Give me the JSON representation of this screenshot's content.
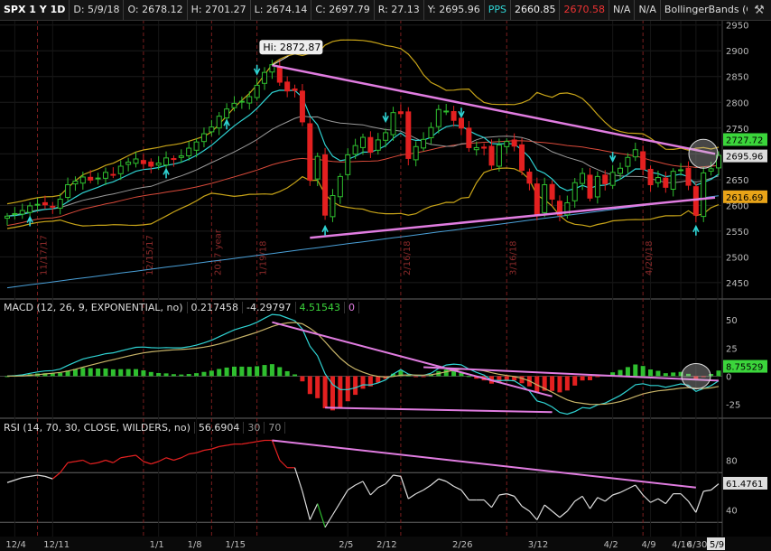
{
  "header": {
    "symbol": "SPX 1 Y 1D",
    "date": "D: 5/9/18",
    "open": "O: 2678.12",
    "high": "H: 2701.27",
    "low": "L: 2674.14",
    "close": "C: 2697.79",
    "range": "R: 27.13",
    "prev": "Y: 2695.96",
    "pps_label": "PPS",
    "pps_value1": "2660.85",
    "pps_value2": "2670.58",
    "na1": "N/A",
    "na2": "N/A",
    "study": "BollingerBands (CLOSE,..."
  },
  "macd_header": {
    "name": "MACD (12, 26, 9, EXPONENTIAL, no)",
    "v1": "0.217458",
    "v2": "-4.29797",
    "v3": "4.51543",
    "v4": "0"
  },
  "rsi_header": {
    "name": "RSI (14, 70, 30, CLOSE, WILDERS, no)",
    "v1": "56.6904",
    "v2": "30",
    "v3": "70"
  },
  "colors": {
    "up": "#2fbf2f",
    "down": "#e32020",
    "bollinger": "#c8a418",
    "ma_short": "#2fd3d3",
    "ma_mid": "#9a9a9a",
    "ma_long": "#d94a3a",
    "ma_200": "#4aa0d8",
    "trendline": "#e07ce0"
  },
  "chart_data": [
    {
      "type": "line",
      "title": "SPX 1 Y 1D",
      "ylim": [
        2420,
        2960
      ],
      "y_ticks": [
        2450,
        2500,
        2550,
        2600,
        2650,
        2700,
        2750,
        2800,
        2850,
        2900,
        2950
      ],
      "x_tick_labels": [
        "12/4",
        "12/11",
        "1/1",
        "1/8",
        "1/15",
        "2/5",
        "2/12",
        "2/26",
        "3/12",
        "4/2",
        "4/9",
        "4/16",
        "4/30",
        "5/9"
      ],
      "vertical_markers": [
        "11/17/17",
        "12/15/17",
        "2017 year",
        "1/19/18",
        "2/16/18",
        "3/16/18",
        "4/20/18"
      ],
      "annotations": [
        "Hi: 2872.87"
      ],
      "price_tags": {
        "upper_band": "2727.72",
        "last": "2695.96",
        "lower_band": "2616.69"
      },
      "close_series": [
        2579,
        2584,
        2590,
        2599,
        2602,
        2601,
        2597,
        2612,
        2640,
        2647,
        2655,
        2649,
        2653,
        2664,
        2660,
        2676,
        2684,
        2690,
        2681,
        2676,
        2682,
        2692,
        2689,
        2696,
        2711,
        2723,
        2739,
        2752,
        2773,
        2787,
        2798,
        2802,
        2811,
        2833,
        2858,
        2873,
        2839,
        2822,
        2823,
        2762,
        2649,
        2695,
        2581,
        2619,
        2656,
        2698,
        2716,
        2732,
        2703,
        2727,
        2741,
        2780,
        2778,
        2691,
        2714,
        2728,
        2751,
        2786,
        2783,
        2765,
        2750,
        2712,
        2712,
        2711,
        2678,
        2717,
        2724,
        2715,
        2668,
        2643,
        2582,
        2640,
        2612,
        2581,
        2605,
        2644,
        2662,
        2614,
        2656,
        2642,
        2664,
        2672,
        2693,
        2708,
        2670,
        2640,
        2654,
        2635,
        2666,
        2669,
        2639,
        2581,
        2663,
        2671,
        2697
      ],
      "series": [
        {
          "name": "Bollinger Upper",
          "values": []
        },
        {
          "name": "Bollinger Lower",
          "values": []
        }
      ]
    },
    {
      "type": "bar",
      "title": "MACD (12, 26, 9, EXPONENTIAL, no)",
      "ylim": [
        -35,
        55
      ],
      "y_ticks": [
        -25,
        0,
        25,
        50
      ],
      "last_value": "8.75529"
    },
    {
      "type": "line",
      "title": "RSI (14, 70, 30, CLOSE, WILDERS, no)",
      "ylim": [
        20,
        100
      ],
      "y_ticks": [
        40,
        80
      ],
      "last_value": "61.4761",
      "values": [
        62,
        64,
        66,
        67,
        68,
        67,
        65,
        70,
        78,
        79,
        80,
        77,
        78,
        80,
        78,
        82,
        83,
        84,
        79,
        77,
        79,
        82,
        80,
        82,
        85,
        86,
        88,
        89,
        91,
        92,
        93,
        93,
        94,
        95,
        96,
        96,
        80,
        74,
        74,
        55,
        32,
        45,
        26,
        36,
        46,
        56,
        60,
        63,
        52,
        58,
        61,
        68,
        67,
        49,
        53,
        56,
        60,
        65,
        63,
        59,
        56,
        48,
        48,
        48,
        42,
        52,
        53,
        51,
        43,
        39,
        32,
        44,
        39,
        34,
        39,
        47,
        51,
        41,
        50,
        47,
        52,
        54,
        57,
        60,
        52,
        46,
        49,
        45,
        53,
        53,
        47,
        38,
        55,
        56,
        61
      ]
    }
  ]
}
